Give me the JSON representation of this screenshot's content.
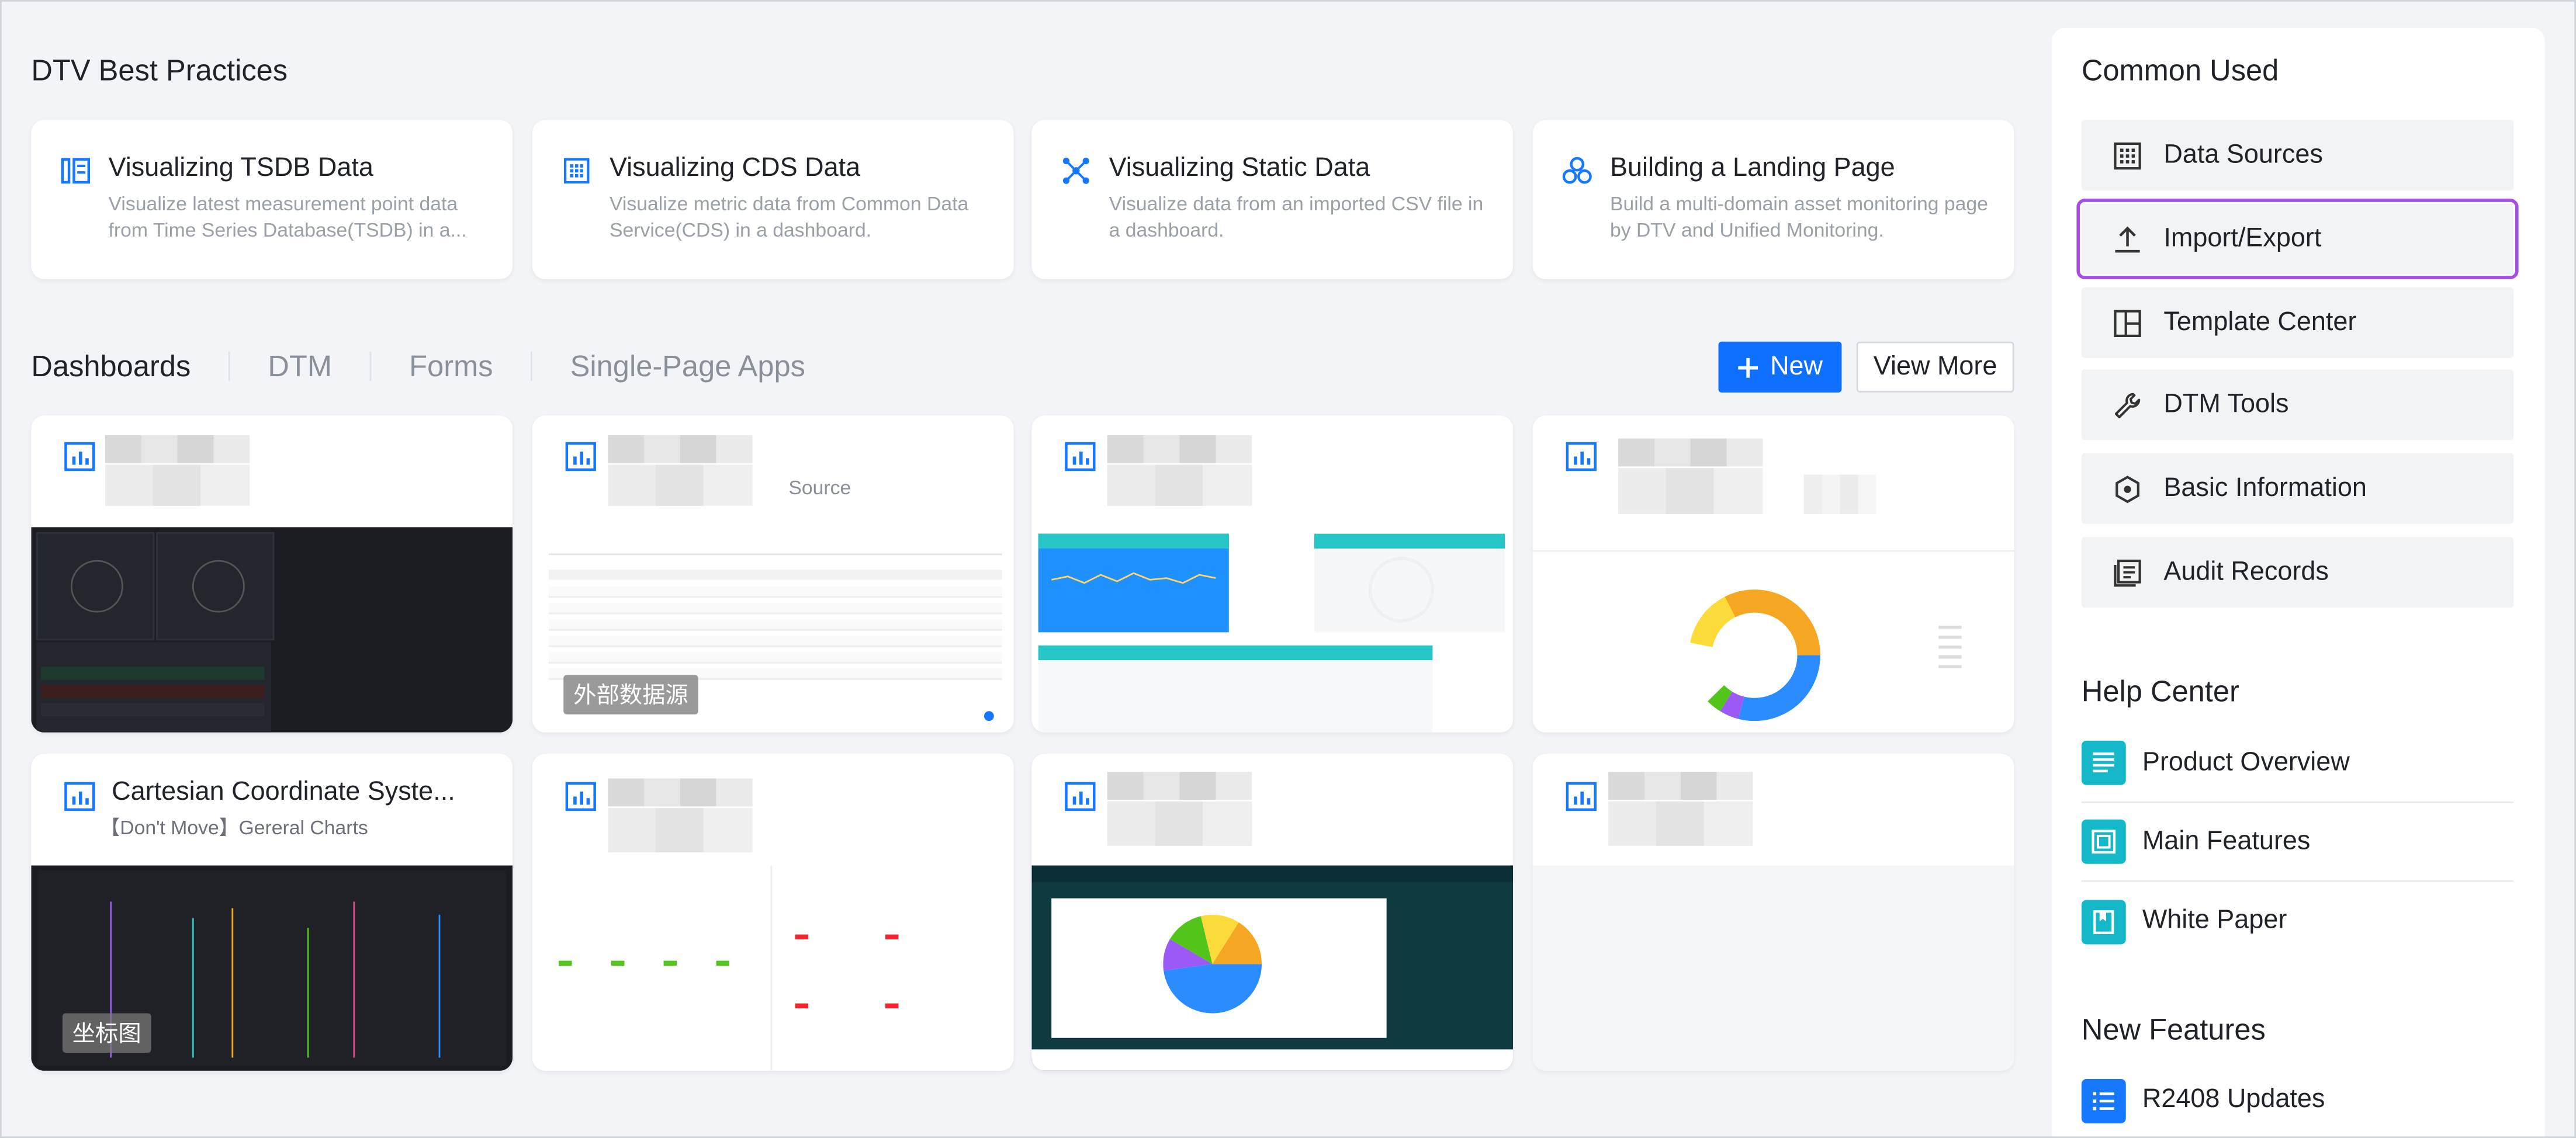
{
  "best_practices": {
    "title": "DTV Best Practices",
    "cards": [
      {
        "icon": "tsdb-icon",
        "title": "Visualizing TSDB Data",
        "desc": "Visualize latest measurement point data from Time Series Database(TSDB) in a..."
      },
      {
        "icon": "cds-grid-icon",
        "title": "Visualizing CDS Data",
        "desc": "Visualize metric data from Common Data Service(CDS) in a dashboard."
      },
      {
        "icon": "static-data-icon",
        "title": "Visualizing Static Data",
        "desc": "Visualize data from an imported CSV file in a dashboard."
      },
      {
        "icon": "landing-page-icon",
        "title": "Building a Landing Page",
        "desc": "Build a multi-domain asset monitoring page by DTV and Unified Monitoring."
      }
    ]
  },
  "tabs": [
    "Dashboards",
    "DTM",
    "Forms",
    "Single-Page Apps"
  ],
  "active_tab": "Dashboards",
  "actions": {
    "new_label": "New",
    "view_more_label": "View More"
  },
  "dashboards": [
    {
      "title": "",
      "subtitle": "",
      "tag": ""
    },
    {
      "title": "",
      "subtitle": "Source",
      "tag": "外部数据源"
    },
    {
      "title": "",
      "subtitle": "",
      "tag": ""
    },
    {
      "title": "",
      "subtitle": "",
      "tag": ""
    },
    {
      "title": "Cartesian Coordinate Syste...",
      "subtitle": "【Don't Move】Gereral Charts",
      "tag": "坐标图"
    },
    {
      "title": "",
      "subtitle": "",
      "tag": ""
    },
    {
      "title": "",
      "subtitle": "",
      "tag": ""
    },
    {
      "title": "",
      "subtitle": "",
      "tag": ""
    }
  ],
  "common_used": {
    "title": "Common Used",
    "items": [
      {
        "icon": "data-sources-icon",
        "label": "Data Sources"
      },
      {
        "icon": "upload-icon",
        "label": "Import/Export"
      },
      {
        "icon": "template-icon",
        "label": "Template Center"
      },
      {
        "icon": "wrench-icon",
        "label": "DTM Tools"
      },
      {
        "icon": "hexagon-info-icon",
        "label": "Basic Information"
      },
      {
        "icon": "audit-records-icon",
        "label": "Audit Records"
      }
    ]
  },
  "help_center": {
    "title": "Help Center",
    "items": [
      {
        "icon": "product-overview-icon",
        "label": "Product Overview"
      },
      {
        "icon": "main-features-icon",
        "label": "Main Features"
      },
      {
        "icon": "white-paper-icon",
        "label": "White Paper"
      }
    ]
  },
  "new_features": {
    "title": "New Features",
    "items": [
      {
        "icon": "updates-list-icon",
        "label": "R2408 Updates"
      }
    ]
  },
  "colors": {
    "accent": "#0f6fff",
    "icon_blue": "#1677ff",
    "teal": "#14b8c8",
    "highlight": "#a64de6"
  }
}
